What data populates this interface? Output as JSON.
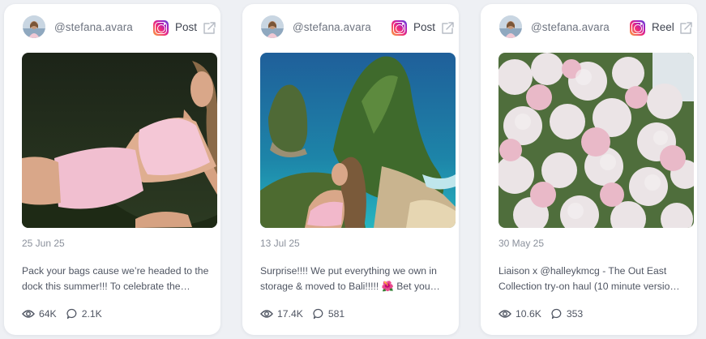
{
  "posts": [
    {
      "handle": "@stefana.avara",
      "platform_icon": "instagram-icon",
      "type": "Post",
      "date": "25 Jun 25",
      "caption": "Pack your bags cause we’re headed to the dock this summer!!! To celebrate the…",
      "views": "64K",
      "comments": "2.1K"
    },
    {
      "handle": "@stefana.avara",
      "platform_icon": "instagram-icon",
      "type": "Post",
      "date": "13 Jul 25",
      "caption": "Surprise!!!! We put everything we own in storage & moved to Bali!!!!! 🌺 Bet you…",
      "views": "17.4K",
      "comments": "581"
    },
    {
      "handle": "@stefana.avara",
      "platform_icon": "instagram-icon",
      "type": "Reel",
      "date": "30 May 25",
      "caption": "Liaison x @halleykmcg - The Out East Collection try-on haul (10 minute versio…",
      "views": "10.6K",
      "comments": "353"
    }
  ],
  "colors": {
    "background": "#eef0f4",
    "card": "#ffffff",
    "text_muted": "#8a909b",
    "instagram_gradient": [
      "#f9a23a",
      "#ee2a7b",
      "#a11fc1",
      "#5b51d8"
    ]
  }
}
